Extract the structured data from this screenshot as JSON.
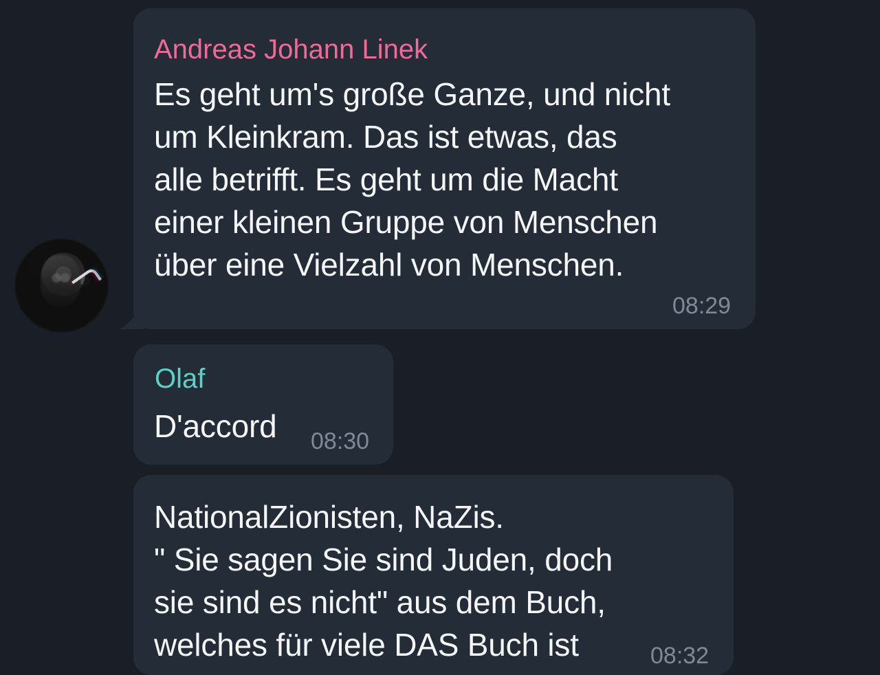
{
  "messages": [
    {
      "sender": "Andreas Johann Linek",
      "sender_color": "#f06a98",
      "lines": [
        "Es geht um's große Ganze, und nicht",
        "um Kleinkram. Das ist etwas, das",
        "alle betrifft. Es geht um die Macht",
        "einer kleinen Gruppe von Menschen",
        "über eine Vielzahl von Menschen."
      ],
      "time": "08:29"
    },
    {
      "sender": "Olaf",
      "sender_color": "#58d3c7",
      "lines": [
        "D'accord"
      ],
      "time": "08:30"
    },
    {
      "sender": "",
      "lines": [
        "NationalZionisten, NaZis.",
        "\" Sie sagen Sie sind Juden, doch",
        "sie sind es nicht\" aus dem Buch,",
        "welches für viele DAS Buch ist"
      ],
      "time": "08:32"
    }
  ],
  "avatar_icon": "user-avatar-image",
  "colors": {
    "background": "#1a1f27",
    "bubble": "#242c38",
    "message_text": "#f4f6f8",
    "timestamp": "#7f8a98"
  }
}
